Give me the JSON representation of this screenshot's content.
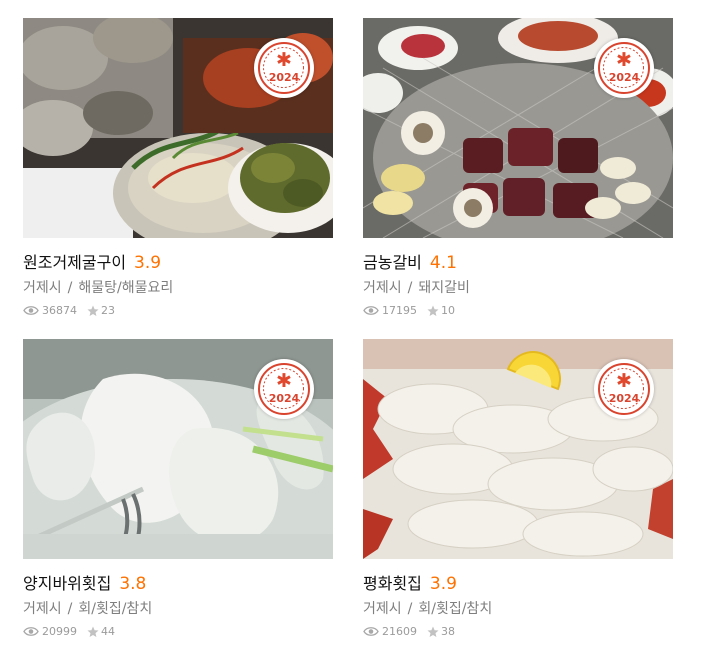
{
  "restaurants": [
    {
      "name": "원조거제굴구이",
      "score": "3.9",
      "region": "거제시",
      "category": "해물탕/해물요리",
      "views": "36874",
      "favorites": "23",
      "badge_year": "2024",
      "photo": "oyster-grill-icon"
    },
    {
      "name": "금농갈비",
      "score": "4.1",
      "region": "거제시",
      "category": "돼지갈비",
      "views": "17195",
      "favorites": "10",
      "badge_year": "2024",
      "photo": "pork-grill-icon"
    },
    {
      "name": "양지바위횟집",
      "score": "3.8",
      "region": "거제시",
      "category": "회/횟집/참치",
      "views": "20999",
      "favorites": "44",
      "badge_year": "2024",
      "photo": "raw-fish-soup-icon"
    },
    {
      "name": "평화횟집",
      "score": "3.9",
      "region": "거제시",
      "category": "회/횟집/참치",
      "views": "21609",
      "favorites": "38",
      "badge_year": "2024",
      "photo": "sliced-raw-fish-icon"
    }
  ],
  "separator": "/",
  "colors": {
    "score": "#ff7100",
    "badge": "#d9442f",
    "meta": "#7f7f7f"
  }
}
